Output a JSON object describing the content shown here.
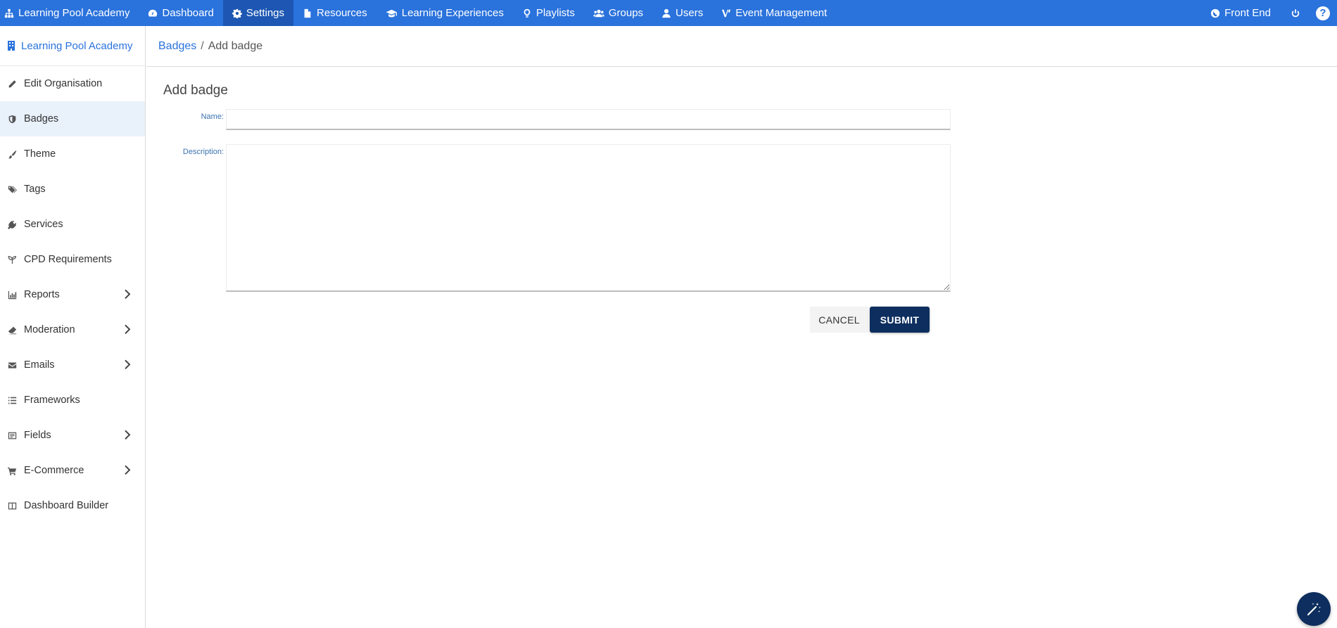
{
  "topnav": {
    "items": [
      {
        "label": "Learning Pool Academy",
        "icon": "sitemap-icon"
      },
      {
        "label": "Dashboard",
        "icon": "tachometer-icon"
      },
      {
        "label": "Settings",
        "icon": "gear-icon",
        "active": true
      },
      {
        "label": "Resources",
        "icon": "file-icon"
      },
      {
        "label": "Learning Experiences",
        "icon": "graduation-cap-icon"
      },
      {
        "label": "Playlists",
        "icon": "lightbulb-icon"
      },
      {
        "label": "Groups",
        "icon": "users-icon"
      },
      {
        "label": "Users",
        "icon": "user-icon"
      },
      {
        "label": "Event Management",
        "icon": "event-logo-icon"
      }
    ],
    "right": {
      "front_end": "Front End",
      "power_icon": "power-icon",
      "help_glyph": "?"
    },
    "color": "#2a72dc"
  },
  "sidebar": {
    "org_label": "Learning Pool Academy",
    "items": [
      {
        "label": "Edit Organisation",
        "icon": "pencil-icon"
      },
      {
        "label": "Badges",
        "icon": "shield-icon",
        "active": true
      },
      {
        "label": "Theme",
        "icon": "paintbrush-icon"
      },
      {
        "label": "Tags",
        "icon": "tags-icon"
      },
      {
        "label": "Services",
        "icon": "plug-icon"
      },
      {
        "label": "CPD Requirements",
        "icon": "seedling-icon"
      },
      {
        "label": "Reports",
        "icon": "bar-chart-icon",
        "expandable": true
      },
      {
        "label": "Moderation",
        "icon": "eraser-icon",
        "expandable": true
      },
      {
        "label": "Emails",
        "icon": "envelope-icon",
        "expandable": true
      },
      {
        "label": "Frameworks",
        "icon": "list-icon"
      },
      {
        "label": "Fields",
        "icon": "form-icon",
        "expandable": true
      },
      {
        "label": "E-Commerce",
        "icon": "cart-icon",
        "expandable": true
      },
      {
        "label": "Dashboard Builder",
        "icon": "columns-icon"
      }
    ]
  },
  "breadcrumb": {
    "parent": "Badges",
    "separator": "/",
    "current": "Add badge"
  },
  "form": {
    "title": "Add badge",
    "name_label": "Name:",
    "name_value": "",
    "description_label": "Description:",
    "description_value": "",
    "cancel_label": "CANCEL",
    "submit_label": "SUBMIT",
    "submit_color": "#0d2e5e"
  },
  "fab": {
    "icon": "magic-wand-icon"
  }
}
